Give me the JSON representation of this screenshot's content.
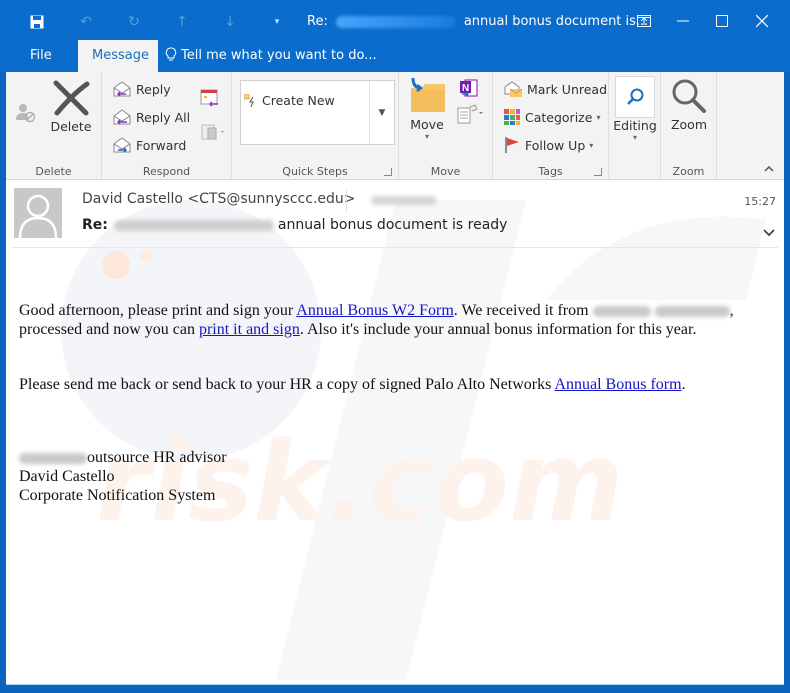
{
  "window": {
    "title_prefix": "Re:",
    "title_suffix": "annual bonus document is...",
    "controls": {
      "restore_ribbon": "ribbon-display-icon",
      "minimize": "–",
      "maximize": "☐",
      "close": "✕"
    }
  },
  "quick_access": [
    {
      "name": "save-icon",
      "glyph": "💾"
    },
    {
      "name": "undo-icon",
      "glyph": "↶"
    },
    {
      "name": "redo-icon",
      "glyph": "↻"
    },
    {
      "name": "up-icon",
      "glyph": "↑"
    },
    {
      "name": "down-icon",
      "glyph": "↓"
    },
    {
      "name": "customize-icon",
      "glyph": "▾"
    }
  ],
  "tabs": [
    {
      "label": "File",
      "active": false
    },
    {
      "label": "Message",
      "active": true
    }
  ],
  "tell_me": "Tell me what you want to do...",
  "ribbon": {
    "delete_group": {
      "label": "Delete",
      "delete_button": "Delete"
    },
    "respond_group": {
      "label": "Respond",
      "reply": "Reply",
      "reply_all": "Reply All",
      "forward": "Forward"
    },
    "quick_steps_group": {
      "label": "Quick Steps",
      "create_new": "Create New"
    },
    "move_group": {
      "label": "Move",
      "move_button": "Move"
    },
    "tags_group": {
      "label": "Tags",
      "mark_unread": "Mark Unread",
      "categorize": "Categorize",
      "follow_up": "Follow Up"
    },
    "editing_group": {
      "label": "",
      "editing_button": "Editing"
    },
    "zoom_group": {
      "label": "Zoom",
      "zoom_button": "Zoom"
    }
  },
  "message": {
    "sender": "David Castello <CTS@sunnysccc.edu>",
    "subject_prefix": "Re:",
    "subject_suffix": "annual bonus document is ready",
    "time": "15:27",
    "body": {
      "p1_a": "Good afternoon, please print and sign your ",
      "p1_link1": "Annual Bonus W2 Form",
      "p1_b": ". We received it from ",
      "p1_c": ", processed and now you can ",
      "p1_link2": "print it and sign",
      "p1_d": ". Also it's include your annual bonus information for this year.",
      "p2_a": "Please send me back or send back to your HR a copy of signed Palo Alto Networks ",
      "p2_link": "Annual Bonus form",
      "p2_b": ".",
      "sig_line1": "outsource HR advisor",
      "sig_line2": "David Castello",
      "sig_line3": "Corporate Notification System"
    }
  },
  "colors": {
    "title_bar": "#0a6ccc",
    "link": "#1515c8",
    "ribbon_bg": "#f3f3f3"
  }
}
